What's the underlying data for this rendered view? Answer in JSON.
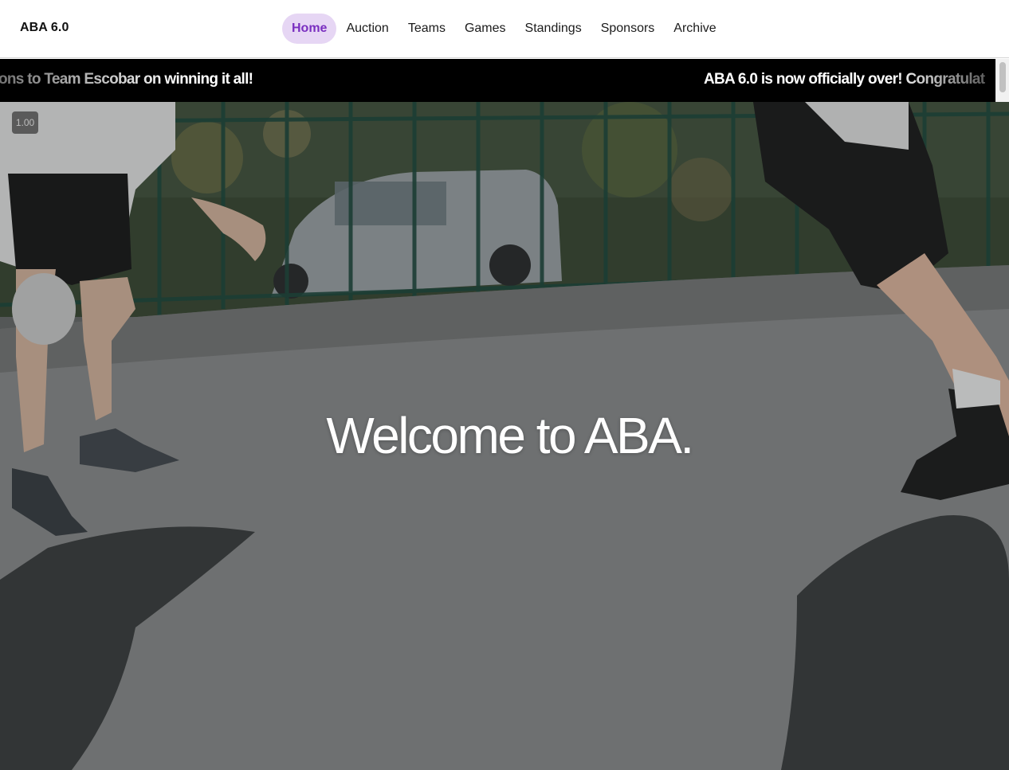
{
  "brand": {
    "title": "ABA 6.0"
  },
  "nav": {
    "items": [
      {
        "label": "Home",
        "active": true
      },
      {
        "label": "Auction",
        "active": false
      },
      {
        "label": "Teams",
        "active": false
      },
      {
        "label": "Games",
        "active": false
      },
      {
        "label": "Standings",
        "active": false
      },
      {
        "label": "Sponsors",
        "active": false
      },
      {
        "label": "Archive",
        "active": false
      }
    ]
  },
  "ticker": {
    "left_fragment": "ons to Team Escobar on winning it all!",
    "right_fragment": "ABA 6.0 is now officially over! Congratulat"
  },
  "hero": {
    "playback_speed": "1.00",
    "title": "Welcome to ABA."
  },
  "colors": {
    "accent": "#7a2fc0",
    "accent_bg": "#e6d6f4",
    "ticker_bg": "#000000",
    "hero_text": "#ffffff"
  }
}
